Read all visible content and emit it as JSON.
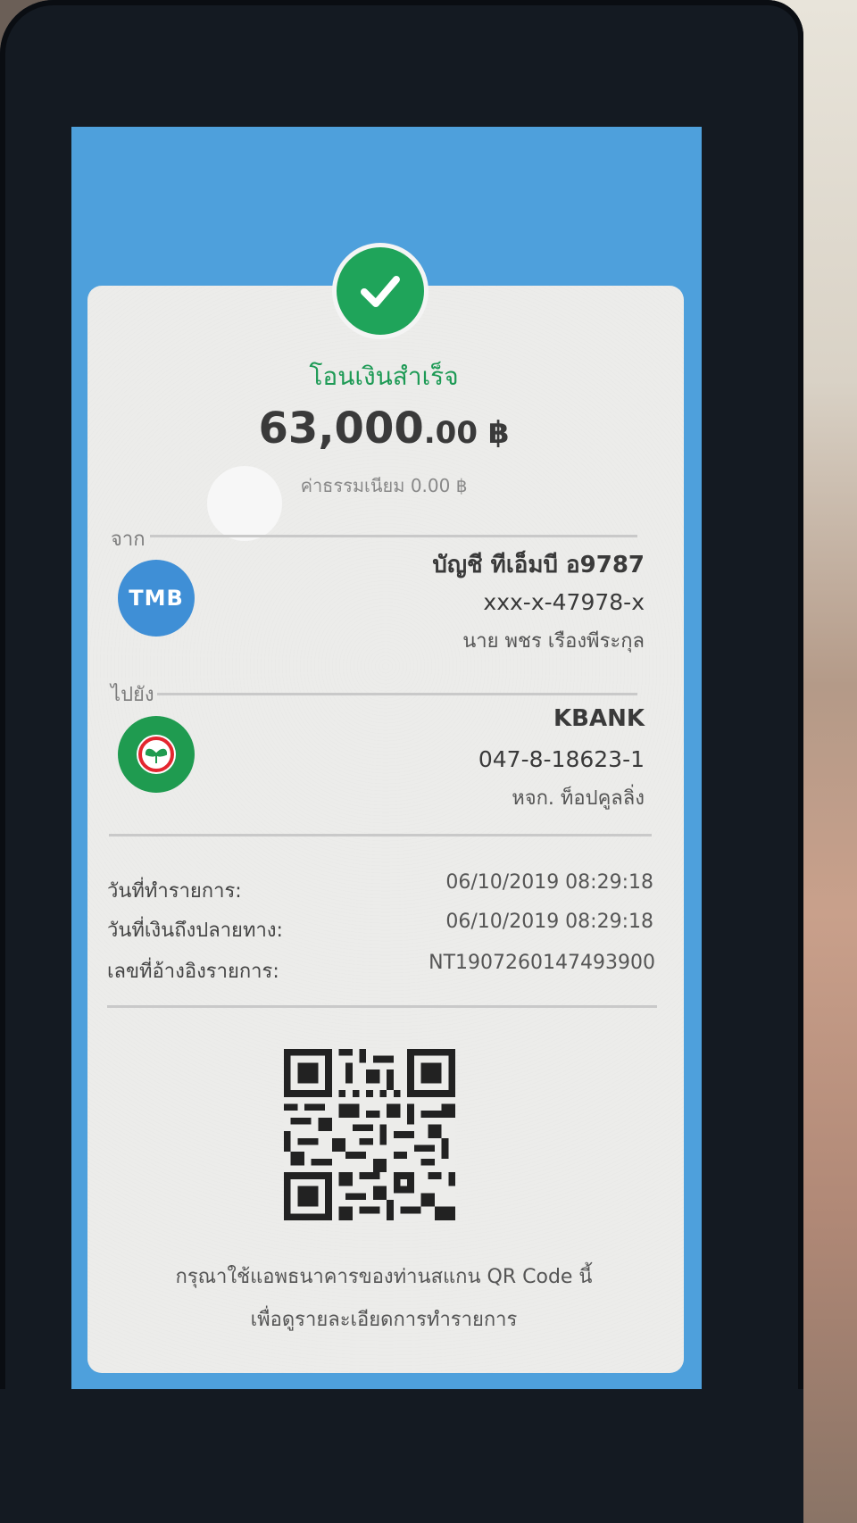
{
  "status": {
    "title": "โอนเงินสำเร็จ",
    "amount_main": "63,000",
    "amount_decimal": ".00 ฿",
    "fee": "ค่าธรรมเนียม 0.00 ฿"
  },
  "from": {
    "label": "จาก",
    "bank_logo_text": "TMB",
    "account_name": "บัญชี ทีเอ็มบี อ9787",
    "account_number": "xxx-x-47978-x",
    "owner": "นาย พชร เรืองพีระกุล"
  },
  "to": {
    "label": "ไปยัง",
    "bank_icon": "kbank-logo-icon",
    "bank": "KBANK",
    "account_number": "047-8-18623-1",
    "owner": "หจก. ท็อปคูลลิ่ง"
  },
  "details": [
    {
      "label": "วันที่ทำรายการ:",
      "value": "06/10/2019 08:29:18"
    },
    {
      "label": "วันที่เงินถึงปลายทาง:",
      "value": "06/10/2019 08:29:18"
    },
    {
      "label": "เลขที่อ้างอิงรายการ:",
      "value": "NT1907260147493900"
    }
  ],
  "qr_caption": {
    "line1": "กรุณาใช้แอพธนาคารของท่านสแกน QR Code นี้",
    "line2": "เพื่อดูรายละเอียดการทำรายการ"
  },
  "colors": {
    "screen_bg": "#4ea0dc",
    "success_green": "#1fa45a",
    "tmb_blue": "#3f8fd6",
    "kbank_green": "#1f9b50"
  }
}
